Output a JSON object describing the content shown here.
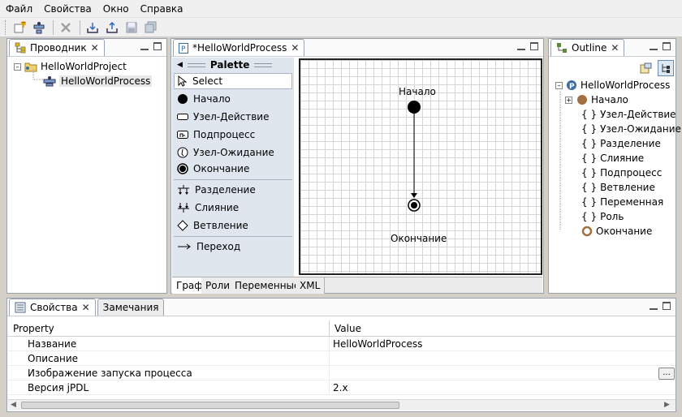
{
  "menu": [
    "Файл",
    "Свойства",
    "Окно",
    "Справка"
  ],
  "explorer": {
    "tab_label": "Проводник",
    "project": "HelloWorldProject",
    "process": "HelloWorldProcess"
  },
  "editor": {
    "tab_label": "*HelloWorldProcess",
    "palette_title": "Palette",
    "palette_items": {
      "select": "Select",
      "start": "Начало",
      "action_node": "Узел-Действие",
      "subprocess": "Подпроцесс",
      "wait_node": "Узел-Ожидание",
      "end": "Окончание",
      "fork": "Разделение",
      "join": "Слияние",
      "decision": "Ветвление",
      "transition": "Переход"
    },
    "diagram": {
      "start_label": "Начало",
      "end_label": "Окончание"
    },
    "bottom_tabs": [
      "Граф",
      "Роли",
      "Переменные",
      "XML"
    ]
  },
  "outline": {
    "tab_label": "Outline",
    "root": "HelloWorldProcess",
    "items": [
      "Начало",
      "Узел-Действие",
      "Узел-Ожидание",
      "Разделение",
      "Слияние",
      "Подпроцесс",
      "Ветвление",
      "Переменная",
      "Роль",
      "Окончание"
    ]
  },
  "bottom": {
    "tab_properties": "Свойства",
    "tab_notes": "Замечания",
    "columns": {
      "property": "Property",
      "value": "Value"
    },
    "rows": [
      {
        "name": "Название",
        "value": "HelloWorldProcess"
      },
      {
        "name": "Описание",
        "value": ""
      },
      {
        "name": "Изображение запуска процесса",
        "value": ""
      },
      {
        "name": "Версия jPDL",
        "value": "2.x"
      }
    ],
    "browse_label": "..."
  },
  "colors": {
    "accent": "#3a6ea5",
    "panel_border": "#9aa3b0",
    "palette_bg": "#dfe6ee"
  }
}
